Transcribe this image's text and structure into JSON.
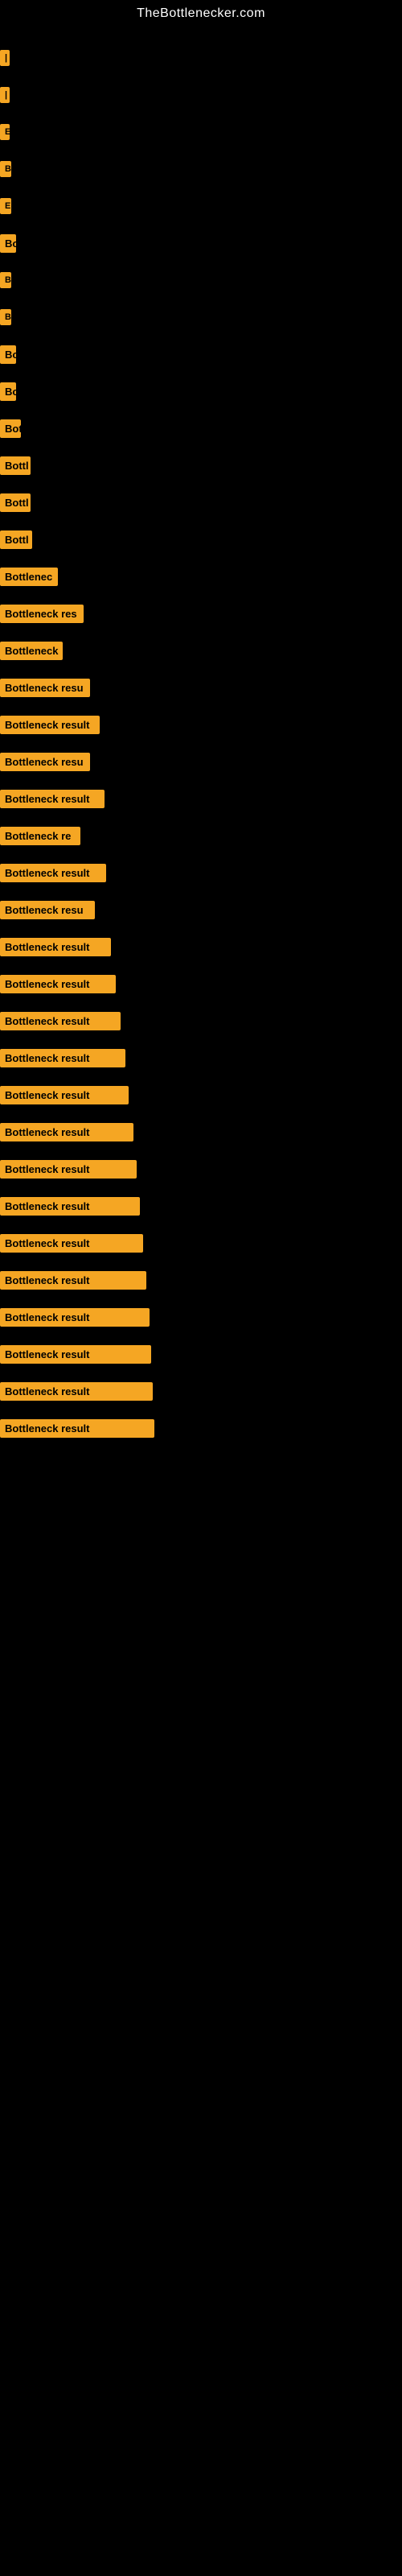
{
  "site": {
    "title": "TheBottlenecker.com"
  },
  "bars": [
    {
      "label": "|",
      "width": 8
    },
    {
      "label": "|",
      "width": 8
    },
    {
      "label": "E",
      "width": 12
    },
    {
      "label": "B",
      "width": 14
    },
    {
      "label": "E",
      "width": 14
    },
    {
      "label": "Bo",
      "width": 20
    },
    {
      "label": "B",
      "width": 14
    },
    {
      "label": "B",
      "width": 14
    },
    {
      "label": "Bo",
      "width": 20
    },
    {
      "label": "Bo",
      "width": 20
    },
    {
      "label": "Bot",
      "width": 26
    },
    {
      "label": "Bottl",
      "width": 38
    },
    {
      "label": "Bottl",
      "width": 38
    },
    {
      "label": "Bottl",
      "width": 40
    },
    {
      "label": "Bottlenec",
      "width": 72
    },
    {
      "label": "Bottleneck res",
      "width": 104
    },
    {
      "label": "Bottleneck",
      "width": 78
    },
    {
      "label": "Bottleneck resu",
      "width": 112
    },
    {
      "label": "Bottleneck result",
      "width": 124
    },
    {
      "label": "Bottleneck resu",
      "width": 112
    },
    {
      "label": "Bottleneck result",
      "width": 130
    },
    {
      "label": "Bottleneck re",
      "width": 100
    },
    {
      "label": "Bottleneck result",
      "width": 132
    },
    {
      "label": "Bottleneck resu",
      "width": 118
    },
    {
      "label": "Bottleneck result",
      "width": 138
    },
    {
      "label": "Bottleneck result",
      "width": 144
    },
    {
      "label": "Bottleneck result",
      "width": 150
    },
    {
      "label": "Bottleneck result",
      "width": 156
    },
    {
      "label": "Bottleneck result",
      "width": 160
    },
    {
      "label": "Bottleneck result",
      "width": 166
    },
    {
      "label": "Bottleneck result",
      "width": 170
    },
    {
      "label": "Bottleneck result",
      "width": 174
    },
    {
      "label": "Bottleneck result",
      "width": 178
    },
    {
      "label": "Bottleneck result",
      "width": 182
    },
    {
      "label": "Bottleneck result",
      "width": 186
    },
    {
      "label": "Bottleneck result",
      "width": 188
    },
    {
      "label": "Bottleneck result",
      "width": 190
    },
    {
      "label": "Bottleneck result",
      "width": 192
    }
  ]
}
